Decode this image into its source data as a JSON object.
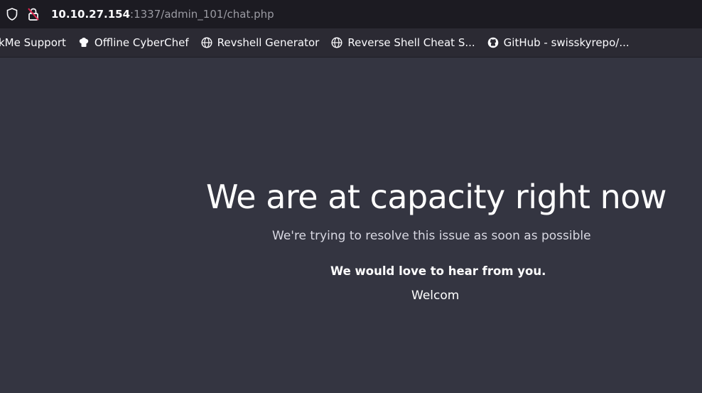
{
  "browser": {
    "url_host": "10.10.27.154",
    "url_rest": ":1337/admin_101/chat.php",
    "icons": [
      "shield-icon",
      "insecure-lock-icon"
    ]
  },
  "bookmarks": [
    {
      "label": "kMe Support",
      "icon": "none"
    },
    {
      "label": "Offline CyberChef",
      "icon": "chef-hat-icon"
    },
    {
      "label": "Revshell Generator",
      "icon": "globe-icon"
    },
    {
      "label": "Reverse Shell Cheat S...",
      "icon": "globe-icon"
    },
    {
      "label": "GitHub - swisskyrepo/...",
      "icon": "github-icon"
    }
  ],
  "page": {
    "title": "We are at capacity right now",
    "subtitle": "We're trying to resolve this issue as soon as possible",
    "love": "We would love to hear from you.",
    "welcome": "Welcom"
  },
  "colors": {
    "page_bg": "#343541",
    "toolbar_bg": "#1c1b22",
    "bookmarks_bg": "#2b2a33",
    "insecure_red": "#e22850"
  }
}
